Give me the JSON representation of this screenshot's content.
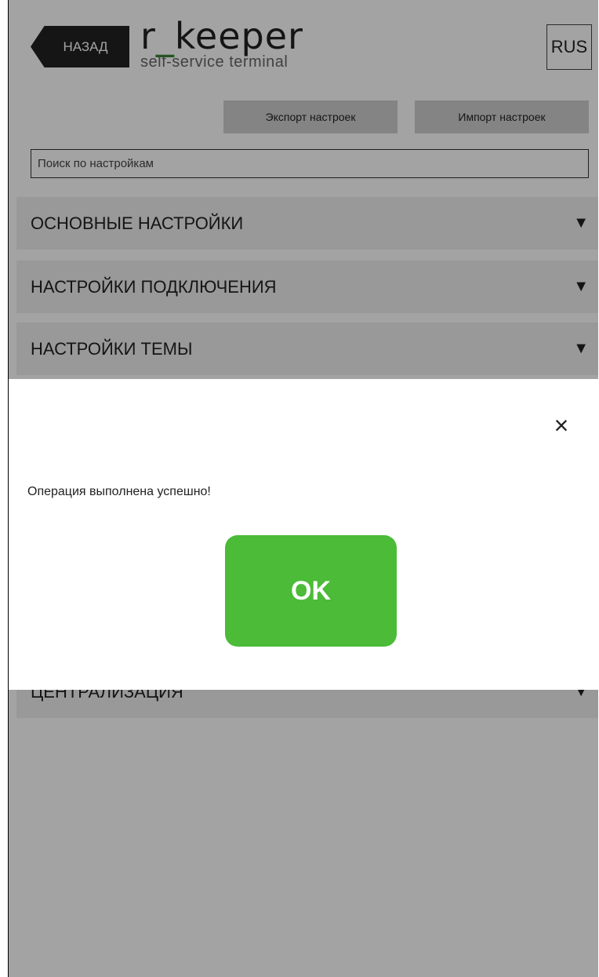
{
  "header": {
    "back_label": "НАЗАД",
    "logo_prefix": "r",
    "logo_underscore": "_",
    "logo_main": "keeper",
    "logo_subtitle": "self-service terminal",
    "language": "RUS"
  },
  "toolbar": {
    "export_label": "Экспорт настроек",
    "import_label": "Импорт настроек"
  },
  "search": {
    "placeholder": "Поиск по настройкам"
  },
  "sections": [
    {
      "label": "ОСНОВНЫЕ НАСТРОЙКИ",
      "arrow": "▼"
    },
    {
      "label": "НАСТРОЙКИ ПОДКЛЮЧЕНИЯ",
      "arrow": "▼"
    },
    {
      "label": "НАСТРОЙКИ ТЕМЫ",
      "arrow": "▼"
    },
    {
      "label": "ЦЕНТРАЛИЗАЦИЯ",
      "arrow": "▼"
    }
  ],
  "modal": {
    "close_symbol": "×",
    "message": "Операция выполнена успешно!",
    "ok_label": "OK"
  },
  "colors": {
    "accent_green": "#4bbb38",
    "logo_green": "#2c8a2c",
    "overlay": "#a3a3a3"
  }
}
